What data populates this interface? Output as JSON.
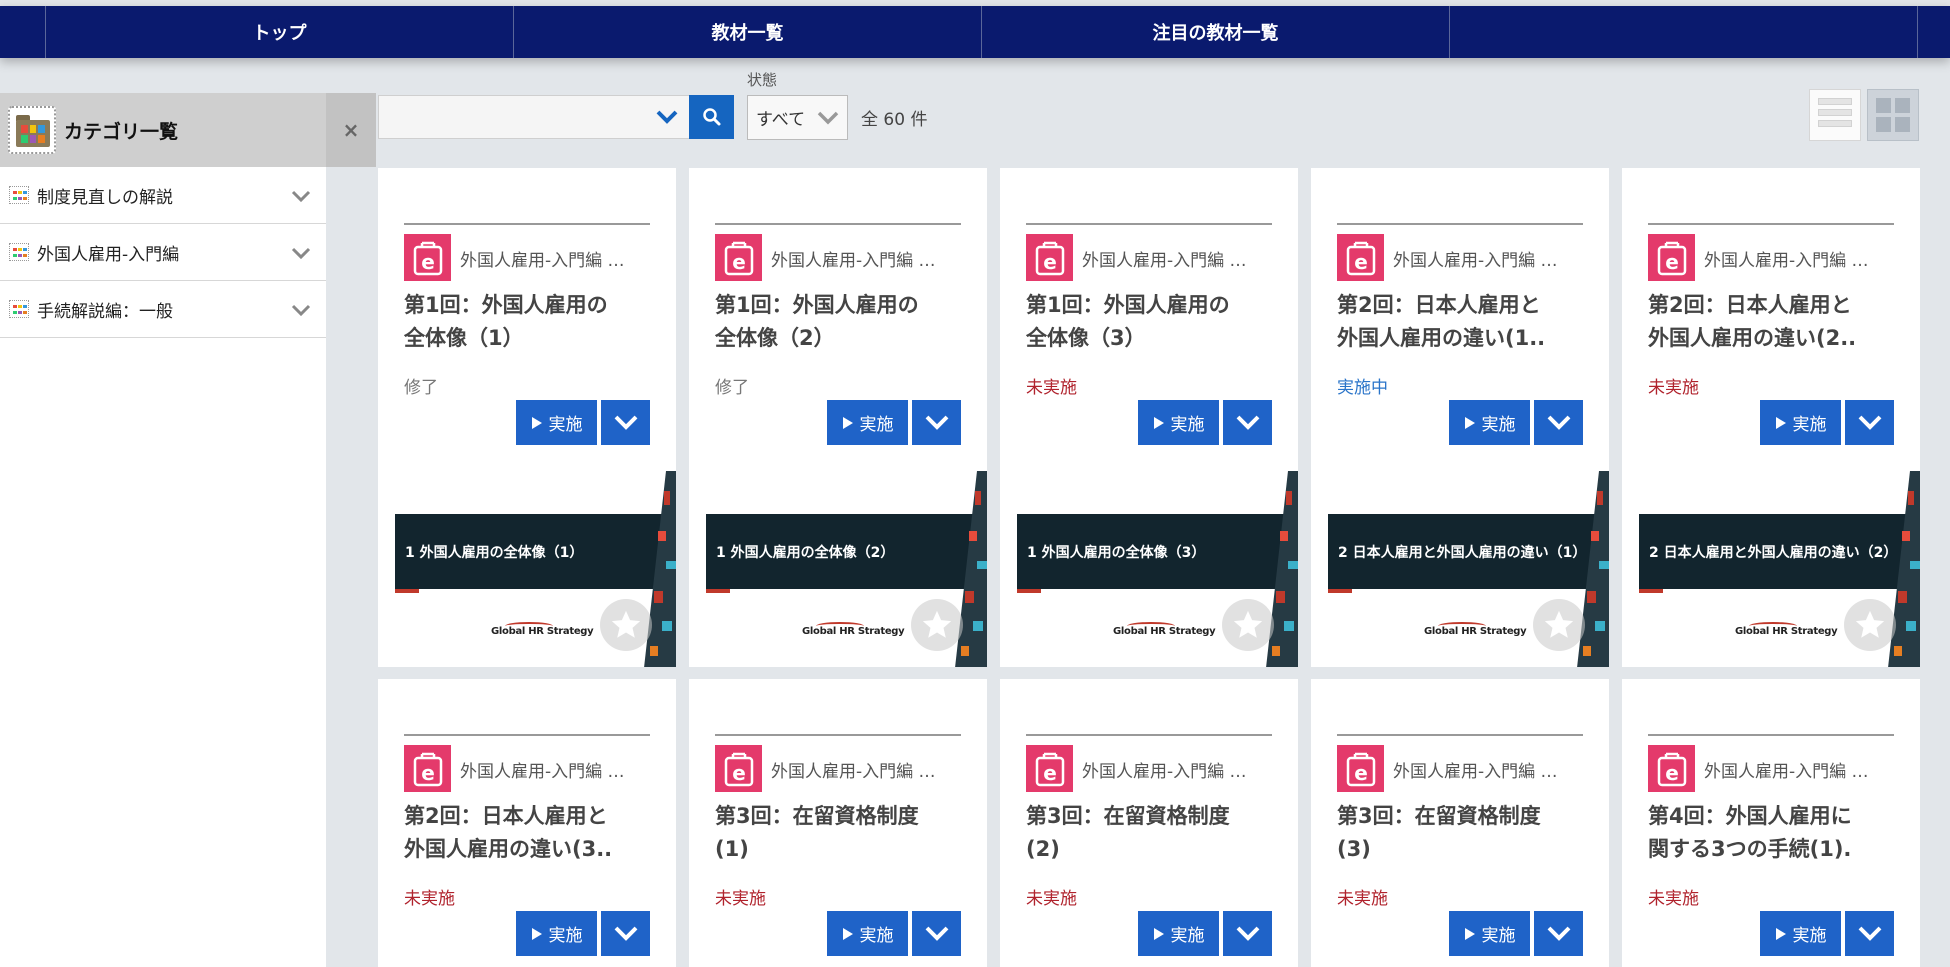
{
  "nav": {
    "items": [
      "トップ",
      "教材一覧",
      "注目の教材一覧",
      ""
    ]
  },
  "sidebar": {
    "title": "カテゴリ一覧",
    "close_label": "×",
    "items": [
      {
        "label": "制度見直しの解説"
      },
      {
        "label": "外国人雇用-入門編"
      },
      {
        "label": "手続解説編：一般"
      }
    ]
  },
  "toolbar": {
    "search_value": "",
    "status_label": "状態",
    "status_value": "すべて",
    "total": "全 60 件"
  },
  "colors": {
    "nav_bg": "#0a1a6e",
    "accent_blue": "#1f63c8",
    "badge_pink": "#e43a6b",
    "status_todo": "#b0222c",
    "status_doing": "#2a74c9"
  },
  "cards": [
    {
      "category": "外国人雇用-入門編 …",
      "title": "第1回：外国人雇用の\n全体像（1）",
      "state": "修了",
      "state_type": "done",
      "run": "実施",
      "thumb": "1  外国人雇用の全体像（1）",
      "logo": "Global HR Strategy"
    },
    {
      "category": "外国人雇用-入門編 …",
      "title": "第1回：外国人雇用の\n全体像（2）",
      "state": "修了",
      "state_type": "done",
      "run": "実施",
      "thumb": "1  外国人雇用の全体像（2）",
      "logo": "Global HR Strategy"
    },
    {
      "category": "外国人雇用-入門編 …",
      "title": "第1回：外国人雇用の\n全体像（3）",
      "state": "未実施",
      "state_type": "todo",
      "run": "実施",
      "thumb": "1  外国人雇用の全体像（3）",
      "logo": "Global HR Strategy"
    },
    {
      "category": "外国人雇用-入門編 …",
      "title": "第2回：日本人雇用と\n外国人雇用の違い(1..",
      "state": "実施中",
      "state_type": "doing",
      "run": "実施",
      "thumb": "2  日本人雇用と外国人雇用の違い（1）",
      "logo": "Global HR Strategy"
    },
    {
      "category": "外国人雇用-入門編 …",
      "title": "第2回：日本人雇用と\n外国人雇用の違い(2..",
      "state": "未実施",
      "state_type": "todo",
      "run": "実施",
      "thumb": "2  日本人雇用と外国人雇用の違い（2）",
      "logo": "Global HR Strategy"
    },
    {
      "category": "外国人雇用-入門編 …",
      "title": "第2回：日本人雇用と\n外国人雇用の違い(3..",
      "state": "未実施",
      "state_type": "todo",
      "run": "実施"
    },
    {
      "category": "外国人雇用-入門編 …",
      "title": "第3回：在留資格制度\n(1)",
      "state": "未実施",
      "state_type": "todo",
      "run": "実施"
    },
    {
      "category": "外国人雇用-入門編 …",
      "title": "第3回：在留資格制度\n(2)",
      "state": "未実施",
      "state_type": "todo",
      "run": "実施"
    },
    {
      "category": "外国人雇用-入門編 …",
      "title": "第3回：在留資格制度\n(3)",
      "state": "未実施",
      "state_type": "todo",
      "run": "実施"
    },
    {
      "category": "外国人雇用-入門編 …",
      "title": "第4回：外国人雇用に\n関する3つの手続(1).",
      "state": "未実施",
      "state_type": "todo",
      "run": "実施"
    }
  ]
}
